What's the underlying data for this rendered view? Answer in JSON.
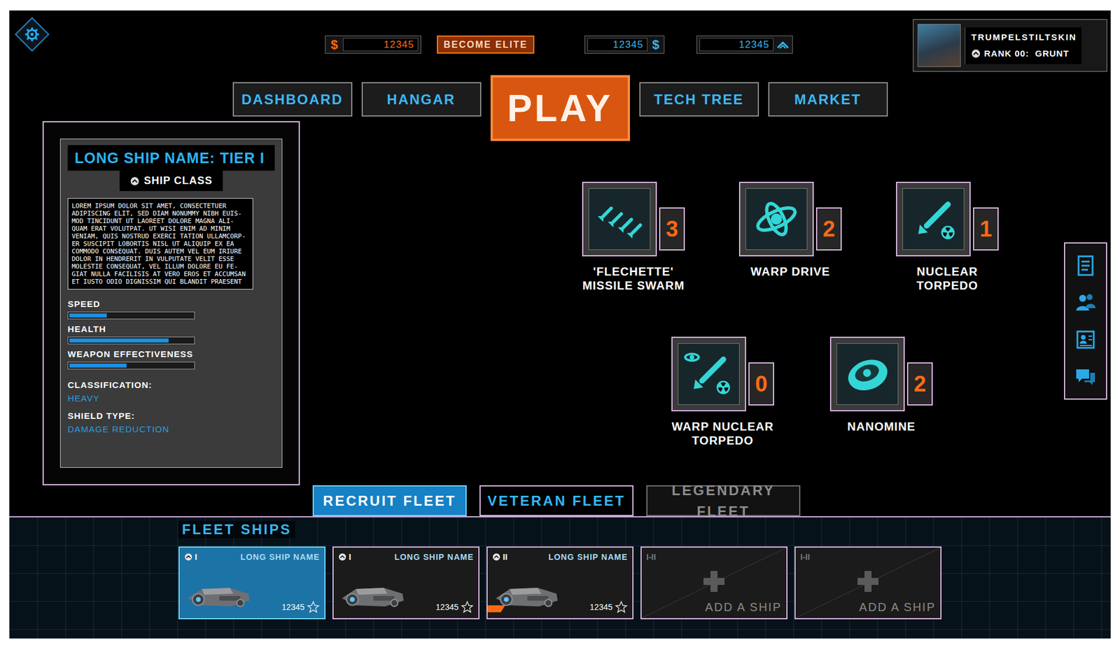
{
  "header": {
    "premium": {
      "symbol": "$",
      "value": "12345"
    },
    "elite_button": "BECOME ELITE",
    "credits": {
      "symbol": "$",
      "value": "12345"
    },
    "xp": {
      "value": "12345"
    },
    "profile": {
      "name": "TRUMPELSTILTSKIN",
      "rank": "RANK 00:  GRUNT"
    }
  },
  "nav": [
    {
      "label": "DASHBOARD",
      "kind": "tab"
    },
    {
      "label": "HANGAR",
      "kind": "tab"
    },
    {
      "label": "PLAY",
      "kind": "play"
    },
    {
      "label": "TECH TREE",
      "kind": "tab"
    },
    {
      "label": "MARKET",
      "kind": "tab"
    }
  ],
  "ship": {
    "title": "LONG SHIP NAME: TIER I",
    "class": "SHIP CLASS",
    "description": "LOREM IPSUM DOLOR SIT AMET, CONSECTETUER ADIPISCING ELIT, SED DIAM NONUMMY NIBH EUIS-MOD TINCIDUNT UT LAOREET DOLORE MAGNA ALI-QUAM ERAT VOLUTPAT. UT WISI ENIM AD MINIM VENIAM, QUIS NOSTRUD EXERCI TATION ULLAMCORP-ER SUSCIPIT LOBORTIS NISL UT ALIQUIP EX EA COMMODO CONSEQUAT. DUIS AUTEM VEL EUM IRIURE DOLOR IN HENDRERIT IN VULPUTATE VELIT ESSE MOLESTIE CONSEQUAT, VEL ILLUM DOLORE EU FE-GIAT NULLA FACILISIS AT VERO EROS ET ACCUMSAN ET IUSTO ODIO DIGNISSIM QUI BLANDIT PRAESENT",
    "stats": [
      {
        "label": "SPEED",
        "level": 0.3
      },
      {
        "label": "HEALTH",
        "level": 0.8
      },
      {
        "label": "WEAPON EFFECTIVENESS",
        "level": 0.46
      }
    ],
    "classification": {
      "label": "CLASSIFICATION:",
      "value": "HEAVY"
    },
    "shield": {
      "label": "SHIELD TYPE:",
      "value": "DAMAGE REDUCTION"
    }
  },
  "weapons": [
    {
      "name": "'FLECHETTE' MISSILE SWARM",
      "count": "3",
      "kind": "missiles"
    },
    {
      "name": "WARP DRIVE",
      "count": "2",
      "kind": "warp"
    },
    {
      "name": "NUCLEAR TORPEDO",
      "count": "1",
      "kind": "torpedo"
    },
    {
      "name": "WARP NUCLEAR TORPEDO",
      "count": "0",
      "kind": "warp-torpedo"
    },
    {
      "name": "NANOMINE",
      "count": "2",
      "kind": "mine"
    }
  ],
  "fleet_tabs": [
    {
      "label": "RECRUIT FLEET",
      "selected": true,
      "disabled": false
    },
    {
      "label": "VETERAN FLEET",
      "selected": false,
      "disabled": false
    },
    {
      "label": "LEGENDARY FLEET",
      "selected": false,
      "disabled": true
    }
  ],
  "fleet": {
    "title": "FLEET SHIPS",
    "ships": [
      {
        "kind": "ship",
        "tier": "I",
        "name": "LONG SHIP NAME",
        "value": "12345",
        "selected": true,
        "marked": false
      },
      {
        "kind": "ship",
        "tier": "I",
        "name": "LONG SHIP NAME",
        "value": "12345",
        "selected": false,
        "marked": false
      },
      {
        "kind": "ship",
        "tier": "II",
        "name": "LONG SHIP NAME",
        "value": "12345",
        "selected": false,
        "marked": true
      },
      {
        "kind": "empty",
        "tier": "I-II",
        "name": "ADD A SHIP",
        "selected": false
      },
      {
        "kind": "empty",
        "tier": "I-II",
        "name": "ADD A SHIP",
        "selected": false
      }
    ]
  }
}
